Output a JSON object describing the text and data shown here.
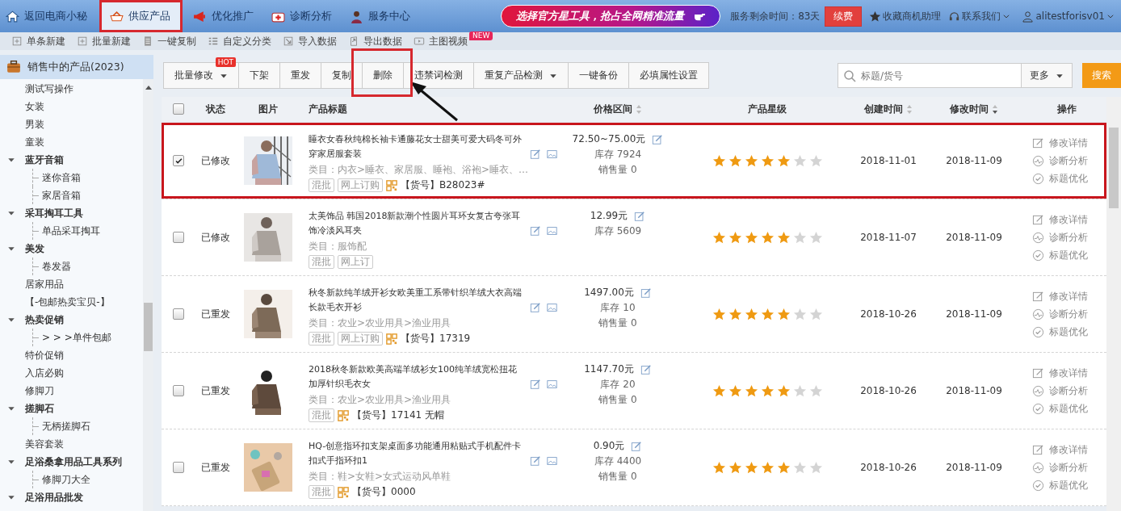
{
  "top_nav": {
    "items": [
      {
        "label": "返回电商小秘",
        "selected": false,
        "highlighted": false
      },
      {
        "label": "供应产品",
        "selected": true,
        "highlighted": true
      },
      {
        "label": "优化推广",
        "selected": false,
        "highlighted": false
      },
      {
        "label": "诊断分析",
        "selected": false,
        "highlighted": false
      },
      {
        "label": "服务中心",
        "selected": false,
        "highlighted": false
      }
    ],
    "banner": "选择官方星工具，抢占全网精准流量",
    "service_time": "服务剩余时间：83天",
    "renew_button": "续费",
    "links": [
      {
        "label": "收藏商机助理",
        "dropdown": false
      },
      {
        "label": "联系我们",
        "dropdown": true
      },
      {
        "label": "alitestforisv01",
        "dropdown": true
      }
    ]
  },
  "quick_toolbar": [
    {
      "label": "单条新建"
    },
    {
      "label": "批量新建"
    },
    {
      "label": "一键复制"
    },
    {
      "label": "自定义分类"
    },
    {
      "label": "导入数据"
    },
    {
      "label": "导出数据"
    },
    {
      "label": "主图视频",
      "badge": "NEW"
    }
  ],
  "sidebar": {
    "header": "销售中的产品(2023)",
    "items": [
      {
        "label": "测试写操作"
      },
      {
        "label": "女装"
      },
      {
        "label": "男装"
      },
      {
        "label": "童装"
      },
      {
        "label": "蓝牙音箱",
        "expanded": true,
        "children": [
          {
            "label": "迷你音箱"
          },
          {
            "label": "家居音箱"
          }
        ]
      },
      {
        "label": "采耳掏耳工具",
        "expanded": true,
        "children": [
          {
            "label": "单品采耳掏耳"
          }
        ]
      },
      {
        "label": "美发",
        "expanded": true,
        "children": [
          {
            "label": "卷发器"
          }
        ]
      },
      {
        "label": "居家用品"
      },
      {
        "label": "【-包邮热卖宝贝-】"
      },
      {
        "label": "热卖促销",
        "expanded": true,
        "children": [
          {
            "label": "> > >单件包邮"
          }
        ]
      },
      {
        "label": "特价促销"
      },
      {
        "label": "入店必购"
      },
      {
        "label": "修脚刀"
      },
      {
        "label": "搓脚石",
        "expanded": true,
        "children": [
          {
            "label": "无柄搓脚石"
          }
        ]
      },
      {
        "label": "美容套装"
      },
      {
        "label": "足浴桑拿用品工具系列",
        "expanded": true,
        "children": [
          {
            "label": "修脚刀大全"
          }
        ]
      },
      {
        "label": "足浴用品批发",
        "expanded": true
      }
    ]
  },
  "action_toolbar": {
    "buttons": [
      {
        "label": "批量修改",
        "dropdown": true,
        "badge": "HOT",
        "highlighted": false
      },
      {
        "label": "下架",
        "dropdown": false,
        "highlighted": false
      },
      {
        "label": "重发",
        "dropdown": false,
        "highlighted": false
      },
      {
        "label": "复制",
        "dropdown": false,
        "highlighted": false
      },
      {
        "label": "删除",
        "dropdown": false,
        "highlighted": true
      },
      {
        "label": "违禁词检测",
        "dropdown": false,
        "highlighted": false
      },
      {
        "label": "重复产品检测",
        "dropdown": true,
        "highlighted": false
      },
      {
        "label": "一键备份",
        "dropdown": false,
        "highlighted": false
      },
      {
        "label": "必填属性设置",
        "dropdown": false,
        "highlighted": false
      }
    ],
    "search": {
      "placeholder": "标题/货号"
    },
    "more": "更多",
    "search_button": "搜索"
  },
  "table": {
    "select_all": {
      "checked": false
    },
    "columns": [
      {
        "label": "状态",
        "sortable": false
      },
      {
        "label": "图片",
        "sortable": false
      },
      {
        "label": "产品标题",
        "sortable": false
      },
      {
        "label": "价格区间",
        "sortable": true,
        "sorted_descending": false
      },
      {
        "label": "产品星级",
        "sortable": false
      },
      {
        "label": "创建时间",
        "sortable": true,
        "sorted_descending": false
      },
      {
        "label": "修改时间",
        "sortable": true,
        "sorted_descending": true
      },
      {
        "label": "操作",
        "sortable": false
      }
    ],
    "rows": [
      {
        "checked": true,
        "highlighted": true,
        "status": "已修改",
        "title": "睡衣女春秋纯棉长袖卡通藤花女士甜美可爱大码冬可外穿家居服套装",
        "category": "类目：内衣>睡衣、家居服、睡袍、浴袍>睡衣、…",
        "tags": [
          "混批",
          "网上订购"
        ],
        "sku": "【货号】B28023#",
        "price": "72.50~75.00元",
        "stock": "库存 7924",
        "sales": "销售量 0",
        "stars": 5,
        "created": "2018-11-01",
        "modified": "2018-11-09",
        "actions": [
          "修改详情",
          "诊断分析",
          "标题优化"
        ]
      },
      {
        "checked": false,
        "highlighted": false,
        "status": "已修改",
        "title": "太美饰品 韩国2018新款潮个性圆片耳环女复古夸张耳饰冷淡风耳夹",
        "category": "类目：服饰配",
        "tags": [
          "混批",
          "网上订"
        ],
        "price": "12.99元",
        "stock": "库存 5609",
        "stars": 5,
        "created": "2018-11-07",
        "modified": "2018-11-09",
        "actions": [
          "修改详情",
          "诊断分析",
          "标题优化"
        ]
      },
      {
        "checked": false,
        "highlighted": false,
        "status": "已重发",
        "title": "秋冬新款纯羊绒开衫女欧美重工系带针织羊绒大衣高端长款毛衣开衫",
        "category": "类目：农业>农业用具>渔业用具",
        "tags": [
          "混批",
          "网上订购"
        ],
        "sku": "【货号】17319",
        "price": "1497.00元",
        "stock": "库存 10",
        "sales": "销售量 0",
        "stars": 5,
        "created": "2018-10-26",
        "modified": "2018-11-09",
        "actions": [
          "修改详情",
          "诊断分析",
          "标题优化"
        ]
      },
      {
        "checked": false,
        "highlighted": false,
        "status": "已重发",
        "title": "2018秋冬新款欧美高端羊绒衫女100纯羊绒宽松扭花加厚针织毛衣女",
        "category": "类目：农业>农业用具>渔业用具",
        "tags": [
          "混批"
        ],
        "sku": "【货号】17141 无帽",
        "price": "1147.70元",
        "stock": "库存 20",
        "sales": "销售量 0",
        "stars": 5,
        "created": "2018-10-26",
        "modified": "2018-11-09",
        "actions": [
          "修改详情",
          "诊断分析",
          "标题优化"
        ]
      },
      {
        "checked": false,
        "highlighted": false,
        "status": "已重发",
        "title": "HQ-创意指环扣支架桌面多功能通用粘贴式手机配件卡扣式手指环扣1",
        "category": "类目：鞋>女鞋>女式运动风单鞋",
        "tags": [
          "混批"
        ],
        "sku": "【货号】0000",
        "price": "0.90元",
        "stock": "库存 4400",
        "sales": "销售量 0",
        "stars": 5,
        "created": "2018-10-26",
        "modified": "2018-11-09",
        "actions": [
          "修改详情",
          "诊断分析",
          "标题优化"
        ]
      }
    ]
  }
}
